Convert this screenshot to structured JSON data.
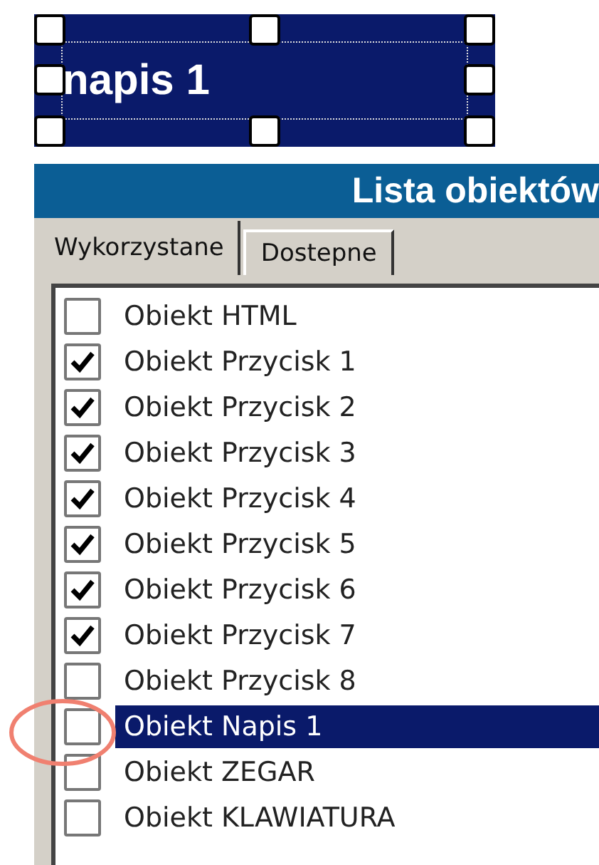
{
  "label_object": {
    "text": "napis 1",
    "selected": true
  },
  "panel": {
    "title": "Lista obiektów"
  },
  "tabs": [
    {
      "label": "Wykorzystane",
      "selected": true
    },
    {
      "label": "Dostepne",
      "selected": false
    }
  ],
  "items": [
    {
      "label": "Obiekt HTML",
      "checked": false,
      "selected": false
    },
    {
      "label": "Obiekt Przycisk 1",
      "checked": true,
      "selected": false
    },
    {
      "label": "Obiekt Przycisk 2",
      "checked": true,
      "selected": false
    },
    {
      "label": "Obiekt Przycisk 3",
      "checked": true,
      "selected": false
    },
    {
      "label": "Obiekt Przycisk 4",
      "checked": true,
      "selected": false
    },
    {
      "label": "Obiekt Przycisk 5",
      "checked": true,
      "selected": false
    },
    {
      "label": "Obiekt Przycisk 6",
      "checked": true,
      "selected": false
    },
    {
      "label": "Obiekt Przycisk 7",
      "checked": true,
      "selected": false
    },
    {
      "label": "Obiekt Przycisk 8",
      "checked": false,
      "selected": false
    },
    {
      "label": "Obiekt Napis 1",
      "checked": false,
      "selected": true,
      "circled": true
    },
    {
      "label": "Obiekt ZEGAR",
      "checked": false,
      "selected": false
    },
    {
      "label": "Obiekt KLAWIATURA",
      "checked": false,
      "selected": false
    }
  ]
}
